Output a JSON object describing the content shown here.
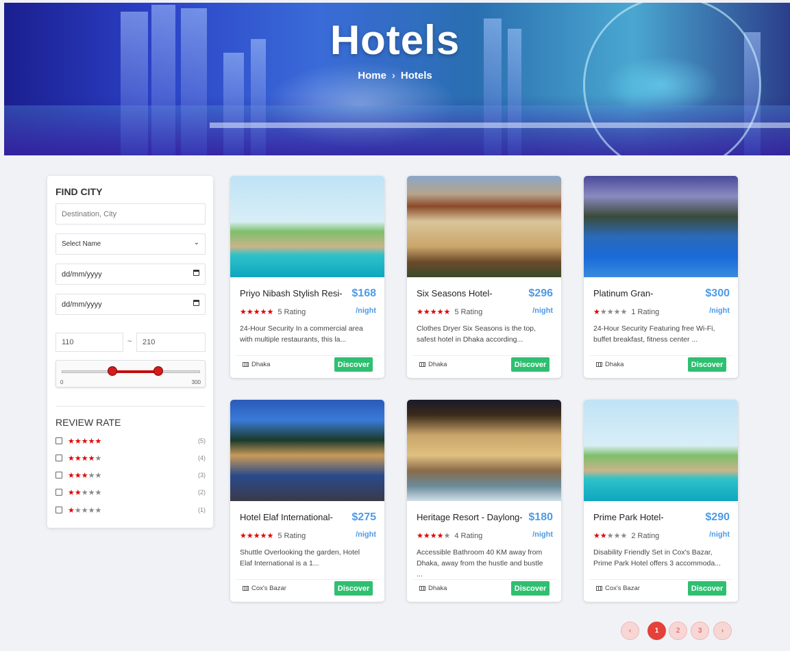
{
  "hero": {
    "title": "Hotels",
    "breadcrumb": {
      "home": "Home",
      "separator": "›",
      "current": "Hotels"
    }
  },
  "sidebar": {
    "find_city_title": "FIND CITY",
    "destination_placeholder": "Destination, City",
    "select_name": "Select Name",
    "date1": "dd/mm/yyyy",
    "date2": "dd/mm/yyyy",
    "price_min": "110",
    "price_sep": "~",
    "price_max": "210",
    "slider": {
      "min_label": "0",
      "max_label": "300",
      "low": 110,
      "high": 210,
      "range_max": 300
    },
    "review_title": "REVIEW RATE",
    "review_rows": [
      {
        "filled": "★★★★★",
        "empty": "",
        "count": "(5)"
      },
      {
        "filled": "★★★★",
        "empty": "★",
        "count": "(4)"
      },
      {
        "filled": "★★★",
        "empty": "★★",
        "count": "(3)"
      },
      {
        "filled": "★★",
        "empty": "★★★",
        "count": "(2)"
      },
      {
        "filled": "★",
        "empty": "★★★★",
        "count": "(1)"
      }
    ]
  },
  "hotels": [
    {
      "name": "Priyo Nibash Stylish Resi-",
      "price": "$168",
      "per": "/night",
      "stars_filled": "★★★★★",
      "stars_empty": "",
      "rating": "5 Rating",
      "desc": "24-Hour Security In a commercial area with multiple restaurants, this la...",
      "location": "Dhaka",
      "button": "Discover"
    },
    {
      "name": "Six Seasons Hotel-",
      "price": "$296",
      "per": "/night",
      "stars_filled": "★★★★★",
      "stars_empty": "",
      "rating": "5 Rating",
      "desc": "Clothes Dryer Six Seasons is the top, safest hotel in Dhaka according...",
      "location": "Dhaka",
      "button": "Discover"
    },
    {
      "name": "Platinum Gran-",
      "price": "$300",
      "per": "/night",
      "stars_filled": "★",
      "stars_empty": "★★★★",
      "rating": "1 Rating",
      "desc": "24-Hour Security Featuring free Wi-Fi, buffet breakfast, fitness center ...",
      "location": "Dhaka",
      "button": "Discover"
    },
    {
      "name": "Hotel Elaf International-",
      "price": "$275",
      "per": "/night",
      "stars_filled": "★★★★★",
      "stars_empty": "",
      "rating": "5 Rating",
      "desc": "Shuttle Overlooking the garden, Hotel Elaf International is a 1...",
      "location": "Cox's Bazar",
      "button": "Discover"
    },
    {
      "name": "Heritage Resort - Daylong-",
      "price": "$180",
      "per": "/night",
      "stars_filled": "★★★★",
      "stars_empty": "★",
      "rating": "4 Rating",
      "desc": "Accessible Bathroom 40 KM away from Dhaka, away from the hustle and bustle ...",
      "location": "Dhaka",
      "button": "Discover"
    },
    {
      "name": "Prime Park Hotel-",
      "price": "$290",
      "per": "/night",
      "stars_filled": "★★",
      "stars_empty": "★★★",
      "rating": "2 Rating",
      "desc": "Disability Friendly Set in Cox's Bazar, Prime Park Hotel offers 3 accommoda...",
      "location": "Cox's Bazar",
      "button": "Discover"
    }
  ],
  "pagination": {
    "prev": "‹",
    "pages": [
      "1",
      "2",
      "3"
    ],
    "next": "›",
    "active": "1"
  },
  "colors": {
    "accent_blue": "#4e9be6",
    "discover_green": "#2fbf71",
    "star_red": "#e00000",
    "page_active": "#e5403a"
  }
}
